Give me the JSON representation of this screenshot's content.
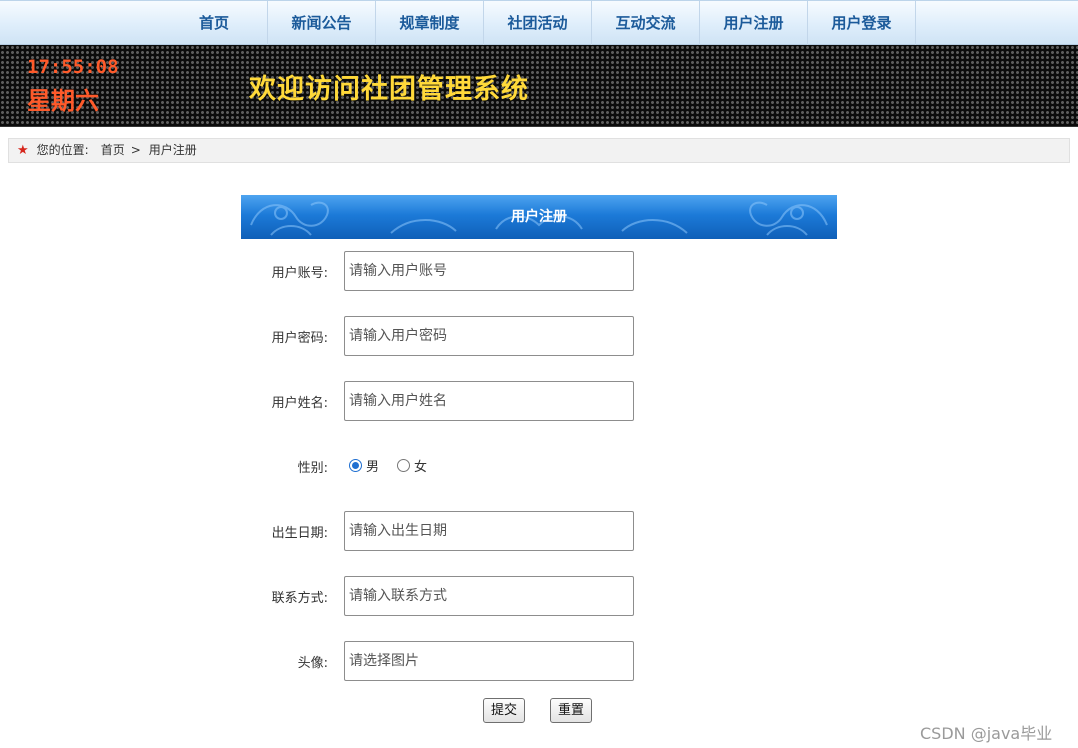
{
  "nav": {
    "items": [
      "首页",
      "新闻公告",
      "规章制度",
      "社团活动",
      "互动交流",
      "用户注册",
      "用户登录"
    ]
  },
  "banner": {
    "time": "17:55:08",
    "day": "星期六",
    "title": "欢迎访问社团管理系统"
  },
  "breadcrumb": {
    "label": "您的位置:",
    "home": "首页",
    "separator": ">",
    "current": "用户注册"
  },
  "form": {
    "title": "用户注册",
    "fields": {
      "account": {
        "label": "用户账号:",
        "placeholder": "请输入用户账号"
      },
      "password": {
        "label": "用户密码:",
        "placeholder": "请输入用户密码"
      },
      "name": {
        "label": "用户姓名:",
        "placeholder": "请输入用户姓名"
      },
      "gender": {
        "label": "性别:",
        "options": [
          "男",
          "女"
        ],
        "selected": "男"
      },
      "birthday": {
        "label": "出生日期:",
        "placeholder": "请输入出生日期"
      },
      "contact": {
        "label": "联系方式:",
        "placeholder": "请输入联系方式"
      },
      "avatar": {
        "label": "头像:",
        "placeholder": "请选择图片"
      }
    },
    "submit_label": "提交",
    "reset_label": "重置"
  },
  "watermark": "CSDN @java毕业",
  "colors": {
    "nav_text": "#1b5a9a",
    "clock": "#ff5a2a",
    "banner_title": "#ffd93a",
    "form_header": "#1c7ad8",
    "star": "#d6261c"
  }
}
